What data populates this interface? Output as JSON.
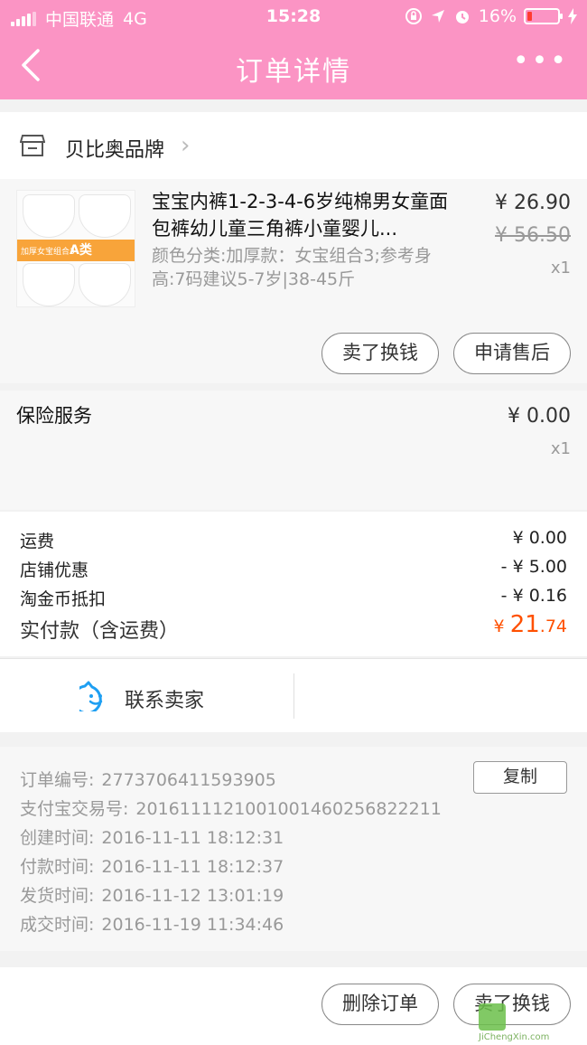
{
  "status_bar": {
    "carrier": "中国联通",
    "network": "4G",
    "time": "15:28",
    "battery": "16%",
    "battery_level": 0.16,
    "battery_color": "#ff3b30"
  },
  "nav": {
    "title": "订单详情",
    "back_icon": "chevron-left-icon",
    "more_icon": "more-dots-icon",
    "more_label": "•••"
  },
  "shop": {
    "name": "贝比奥品牌",
    "icon": "store-icon",
    "chevron": "›"
  },
  "product": {
    "title": "宝宝内裤1-2-3-4-6岁纯棉男女童面包裤幼儿童三角裤小童婴儿...",
    "spec": "颜色分类:加厚款：女宝组合3;参考身高:7码建议5-7岁|38-45斤",
    "price": "¥ 26.90",
    "original_price": "¥ 56.50",
    "quantity": "x1",
    "thumb_band_text": "加厚女宝组合3",
    "thumb_badge": "A类",
    "sell_button": "卖了换钱",
    "after_sale_button": "申请售后"
  },
  "insurance": {
    "label": "保险服务",
    "price": "¥ 0.00",
    "quantity": "x1"
  },
  "fees": {
    "rows": [
      {
        "label": "运费",
        "value": "¥ 0.00"
      },
      {
        "label": "店铺优惠",
        "value": "- ¥ 5.00"
      },
      {
        "label": "淘金币抵扣",
        "value": "- ¥ 0.16"
      }
    ],
    "total_label": "实付款（含运费）",
    "total_currency": "¥ ",
    "total_int": "21",
    "total_dec": ".74",
    "accent_color": "#ff5000"
  },
  "contact": {
    "label": "联系卖家",
    "icon": "chat-face-icon",
    "icon_color": "#1e9ff2"
  },
  "order_info": {
    "rows": [
      {
        "label": "订单编号:",
        "value": "2773706411593905"
      },
      {
        "label": "支付宝交易号:",
        "value": "2016111121001001460256822211"
      },
      {
        "label": "创建时间:",
        "value": "2016-11-11 18:12:31"
      },
      {
        "label": "付款时间:",
        "value": "2016-11-11 18:12:37"
      },
      {
        "label": "发货时间:",
        "value": "2016-11-12 13:01:19"
      },
      {
        "label": "成交时间:",
        "value": "2016-11-19 11:34:46"
      }
    ],
    "copy_button": "复制"
  },
  "bottom_bar": {
    "delete_button": "删除订单",
    "sell_button": "卖了换钱"
  },
  "watermark": {
    "text": "JiChengXin.com"
  },
  "theme": {
    "header_pink": "#fb94c4"
  }
}
